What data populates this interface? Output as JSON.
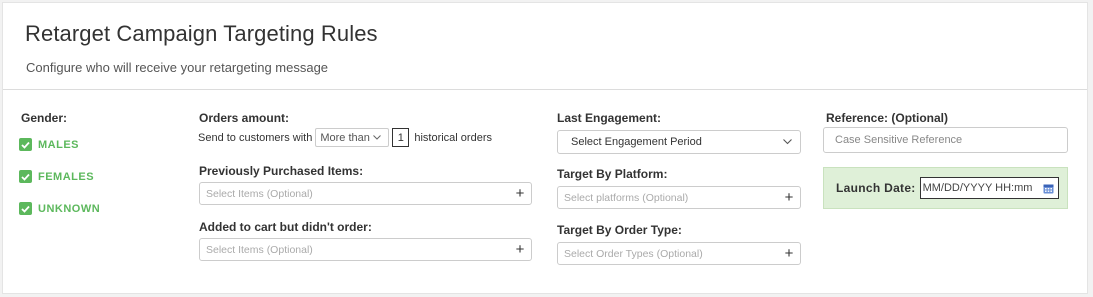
{
  "header": {
    "title": "Retarget Campaign Targeting Rules",
    "subtitle": "Configure who will receive your retargeting message"
  },
  "gender": {
    "label": "Gender:",
    "options": [
      {
        "label": "MALES",
        "checked": true
      },
      {
        "label": "FEMALES",
        "checked": true
      },
      {
        "label": "UNKNOWN",
        "checked": true
      }
    ]
  },
  "orders": {
    "label": "Orders amount:",
    "prefix": "Send to customers with",
    "comparator": "More than",
    "count": "1",
    "suffix": "historical orders"
  },
  "purchased": {
    "label": "Previously Purchased Items:",
    "placeholder": "Select Items (Optional)"
  },
  "cart": {
    "label": "Added to cart but didn't order:",
    "placeholder": "Select Items (Optional)"
  },
  "engagement": {
    "label": "Last Engagement:",
    "value": "Select Engagement Period"
  },
  "platform": {
    "label": "Target By Platform:",
    "placeholder": "Select platforms (Optional)"
  },
  "order_type": {
    "label": "Target By Order Type:",
    "placeholder": "Select Order Types (Optional)"
  },
  "reference": {
    "label": "Reference: (Optional)",
    "placeholder": "Case Sensitive Reference"
  },
  "launch": {
    "label": "Launch Date:",
    "placeholder": "MM/DD/YYYY HH:mm"
  },
  "colors": {
    "accent_green": "#5cb85c",
    "launch_bg": "#dff0d8"
  }
}
